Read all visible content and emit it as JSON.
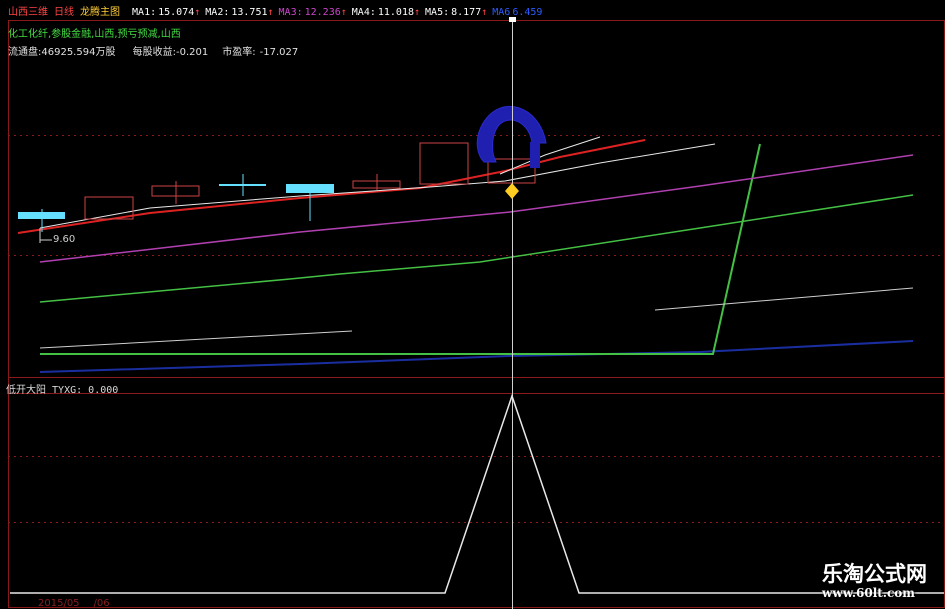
{
  "header": {
    "stock_name": "山西三维",
    "period": "日线",
    "chart_name": "龙腾主图",
    "ma": [
      {
        "label": "MA1:",
        "value": "15.074",
        "arrow": "↑",
        "color": "#ffffff"
      },
      {
        "label": "MA2:",
        "value": "13.751",
        "arrow": "↑",
        "color": "#ffffff"
      },
      {
        "label": "MA3:",
        "value": "12.236",
        "arrow": "↑",
        "color": "#cc44cc"
      },
      {
        "label": "MA4:",
        "value": "11.018",
        "arrow": "↑",
        "color": "#ffffff"
      },
      {
        "label": "MA5:",
        "value": "8.177",
        "arrow": "↑",
        "color": "#ffffff"
      },
      {
        "label": "MA6",
        "value": "6.459",
        "arrow": "",
        "color": "#2b5cff"
      }
    ]
  },
  "info": {
    "sectors": "化工化纤,参股金融,山西,预亏预减,山西",
    "float_label": "流通盘:",
    "float_value": "46925.594万股",
    "eps_label": "每股收益:",
    "eps_value": "-0.201",
    "pe_label": "市盈率:",
    "pe_value": "-17.027"
  },
  "main_chart": {
    "low_marker": "9.60"
  },
  "sub_chart": {
    "indicator": "低开大阳",
    "series_label": "TYXG:",
    "series_value": "0.000"
  },
  "footer": {
    "date": "2015/05",
    "extra": "/06"
  },
  "watermark": {
    "title": "乐淘公式网",
    "url": "www.60lt.com"
  },
  "colors": {
    "grid": "#8a1a1a",
    "candle_up": "#cc4444",
    "candle_flat": "#66e0ff",
    "ma_red": "#dd2222",
    "ma_white": "#e8e8e8",
    "ma_purple": "#b040b0",
    "ma_green": "#44c044",
    "ma_blue": "#1a2ea0",
    "signal": "#2020b0"
  }
}
